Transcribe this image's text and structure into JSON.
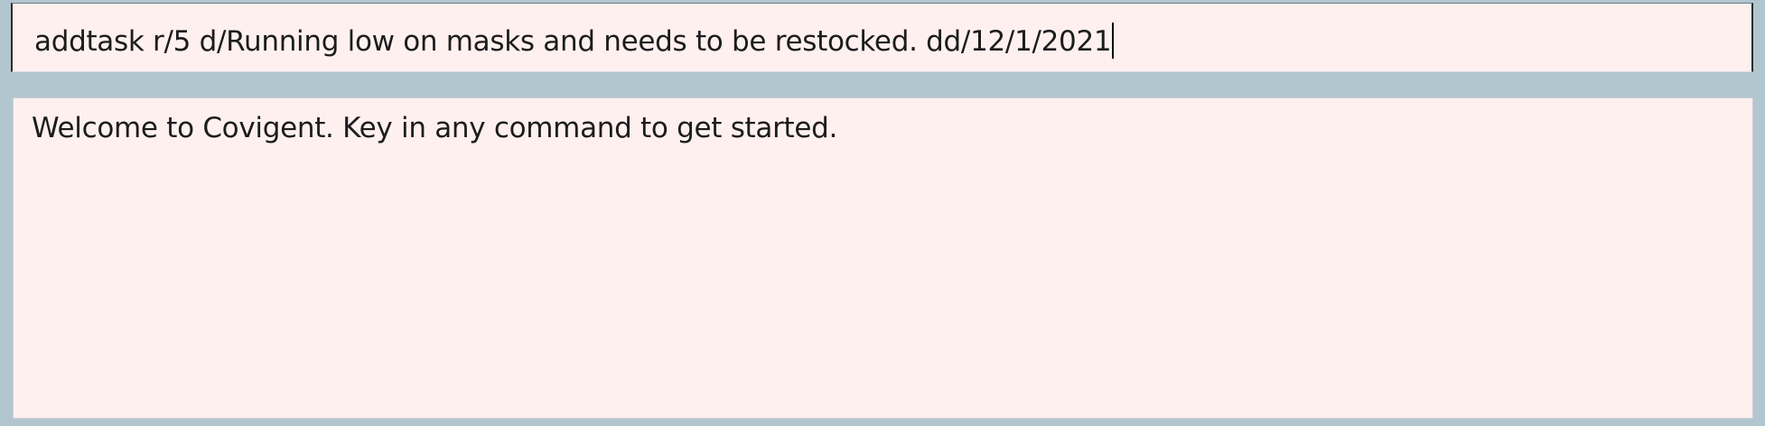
{
  "command_box": {
    "value": "addtask r/5 d/Running low on masks and needs to be restocked. dd/12/1/2021"
  },
  "result_display": {
    "message": "Welcome to Covigent. Key in any command to get started."
  },
  "colors": {
    "background": "#b2c6cf",
    "panel": "#fff0f0",
    "text": "#1c1c1c"
  }
}
